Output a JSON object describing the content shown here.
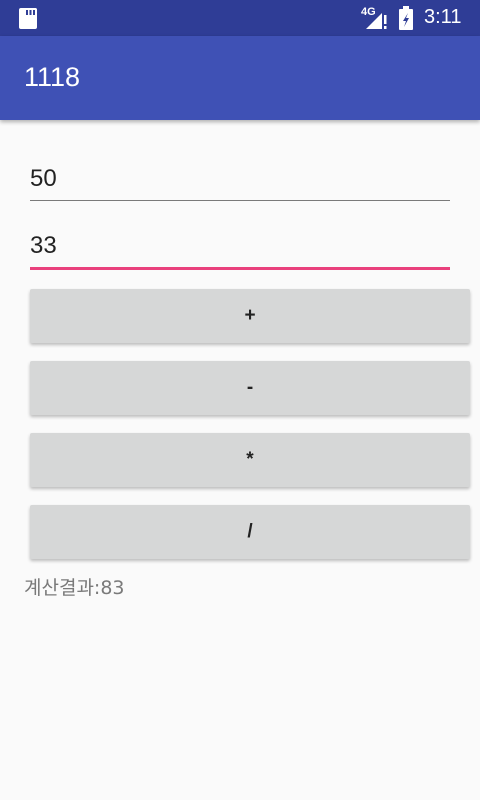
{
  "status_bar": {
    "network": "4G",
    "time": "3:11",
    "icons": [
      "sd-card-icon",
      "signal-icon",
      "battery-icon"
    ]
  },
  "app_bar": {
    "title": "1118",
    "color": "#3f51b5"
  },
  "inputs": {
    "first_value": "50",
    "second_value": "33",
    "accent": "#e9407c"
  },
  "buttons": {
    "plus": "+",
    "minus": "-",
    "multiply": "*",
    "divide": "/"
  },
  "result": {
    "text": "계산결과:83"
  }
}
